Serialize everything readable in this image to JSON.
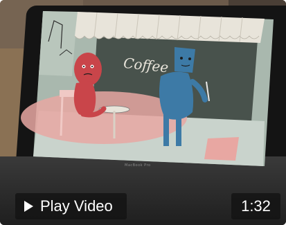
{
  "video": {
    "thumbnail_sign_text": "Coffee",
    "laptop_brand": "MacBook Pro",
    "play_label": "Play Video",
    "duration": "1:32"
  },
  "icons": {
    "play": "play-icon"
  },
  "colors": {
    "overlay_bg": "#141414",
    "overlay_text": "#ffffff",
    "screen_bg": "#a9b8ae",
    "awning": "#e8e4da",
    "red_character": "#c9454a",
    "blue_character": "#3d7aa6",
    "floor_pink": "#e8a7a2"
  }
}
